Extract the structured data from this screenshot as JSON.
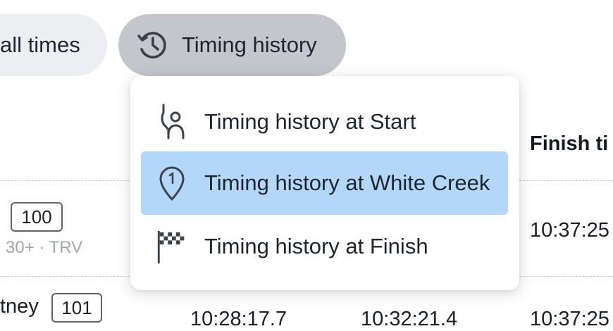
{
  "toolbar": {
    "all_times_label": "all times",
    "timing_history_label": "Timing history"
  },
  "table": {
    "finish_header": "Finish ti",
    "rows": [
      {
        "bib": "100",
        "meta": "30+  ·  TRV",
        "finish": "10:37:25"
      },
      {
        "name": "tney",
        "bib": "101",
        "col1": "10:28:17.7",
        "col2": "10:32:21.4",
        "finish": "10:37:25"
      }
    ]
  },
  "dropdown": {
    "items": [
      {
        "label": "Timing history at Start",
        "icon": "start-person-icon",
        "selected": false
      },
      {
        "label": "Timing history at White Creek",
        "icon": "checkpoint-1-icon",
        "selected": true
      },
      {
        "label": "Timing history at Finish",
        "icon": "checkered-flag-icon",
        "selected": false
      }
    ]
  },
  "colors": {
    "selected_item": "#b2d7f8",
    "active_pill": "#c3c6cb",
    "inactive_pill": "#eceef1"
  }
}
